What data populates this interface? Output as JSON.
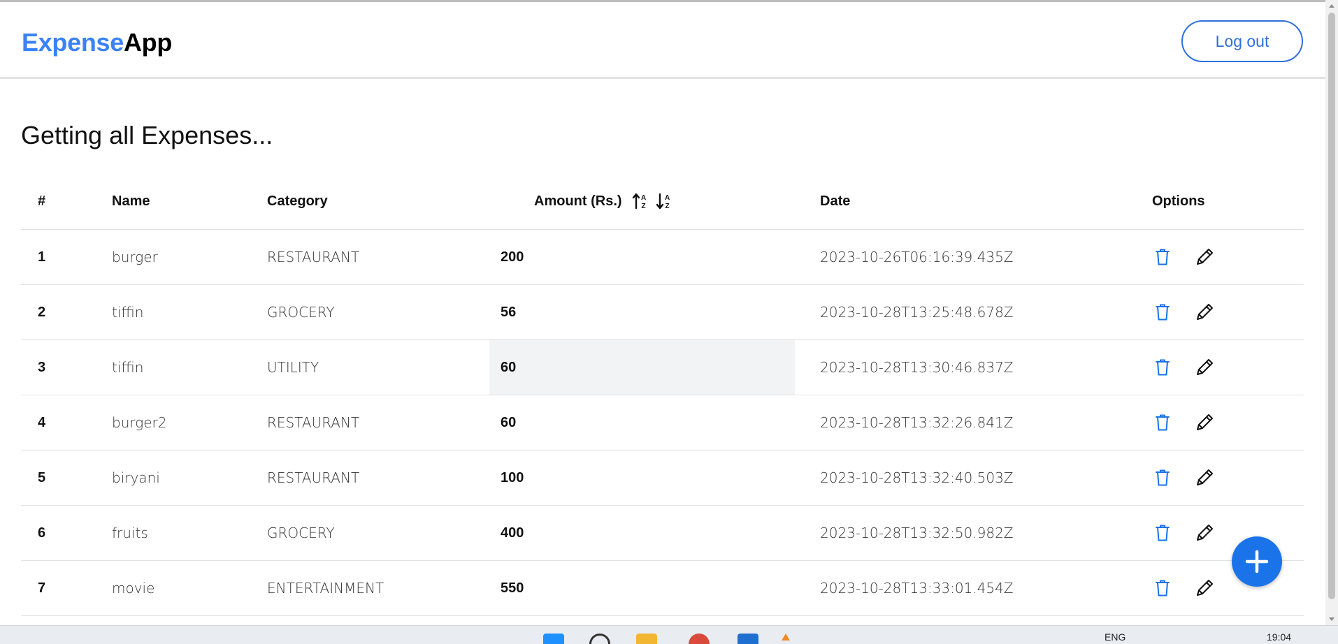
{
  "app": {
    "brand_part1": "Expense",
    "brand_part2": "App",
    "logout_label": "Log out"
  },
  "page": {
    "heading": "Getting all Expenses..."
  },
  "table": {
    "headers": {
      "index": "#",
      "name": "Name",
      "category": "Category",
      "amount": "Amount (Rs.)",
      "date": "Date",
      "options": "Options"
    },
    "rows": [
      {
        "index": "1",
        "name": "burger",
        "category": "RESTAURANT",
        "amount": "200",
        "date": "2023-10-26T06:16:39.435Z"
      },
      {
        "index": "2",
        "name": "tiffin",
        "category": "GROCERY",
        "amount": "56",
        "date": "2023-10-28T13:25:48.678Z"
      },
      {
        "index": "3",
        "name": "tiffin",
        "category": "UTILITY",
        "amount": "60",
        "date": "2023-10-28T13:30:46.837Z"
      },
      {
        "index": "4",
        "name": "burger2",
        "category": "RESTAURANT",
        "amount": "60",
        "date": "2023-10-28T13:32:26.841Z"
      },
      {
        "index": "5",
        "name": "biryani",
        "category": "RESTAURANT",
        "amount": "100",
        "date": "2023-10-28T13:32:40.503Z"
      },
      {
        "index": "6",
        "name": "fruits",
        "category": "GROCERY",
        "amount": "400",
        "date": "2023-10-28T13:32:50.982Z"
      },
      {
        "index": "7",
        "name": "movie",
        "category": "ENTERTAINMENT",
        "amount": "550",
        "date": "2023-10-28T13:33:01.454Z"
      }
    ]
  },
  "icons": {
    "sort_asc": "sort-alpha-up-icon",
    "sort_desc": "sort-alpha-down-icon",
    "delete": "trash-icon",
    "edit": "pencil-icon",
    "add": "plus-icon"
  },
  "colors": {
    "brand_blue": "#3b82f6",
    "primary": "#1a73e8",
    "logout_border": "#2f6fdb",
    "highlight_cell": "#f2f3f4"
  },
  "taskbar": {
    "language": "ENG",
    "time": "19:04"
  }
}
